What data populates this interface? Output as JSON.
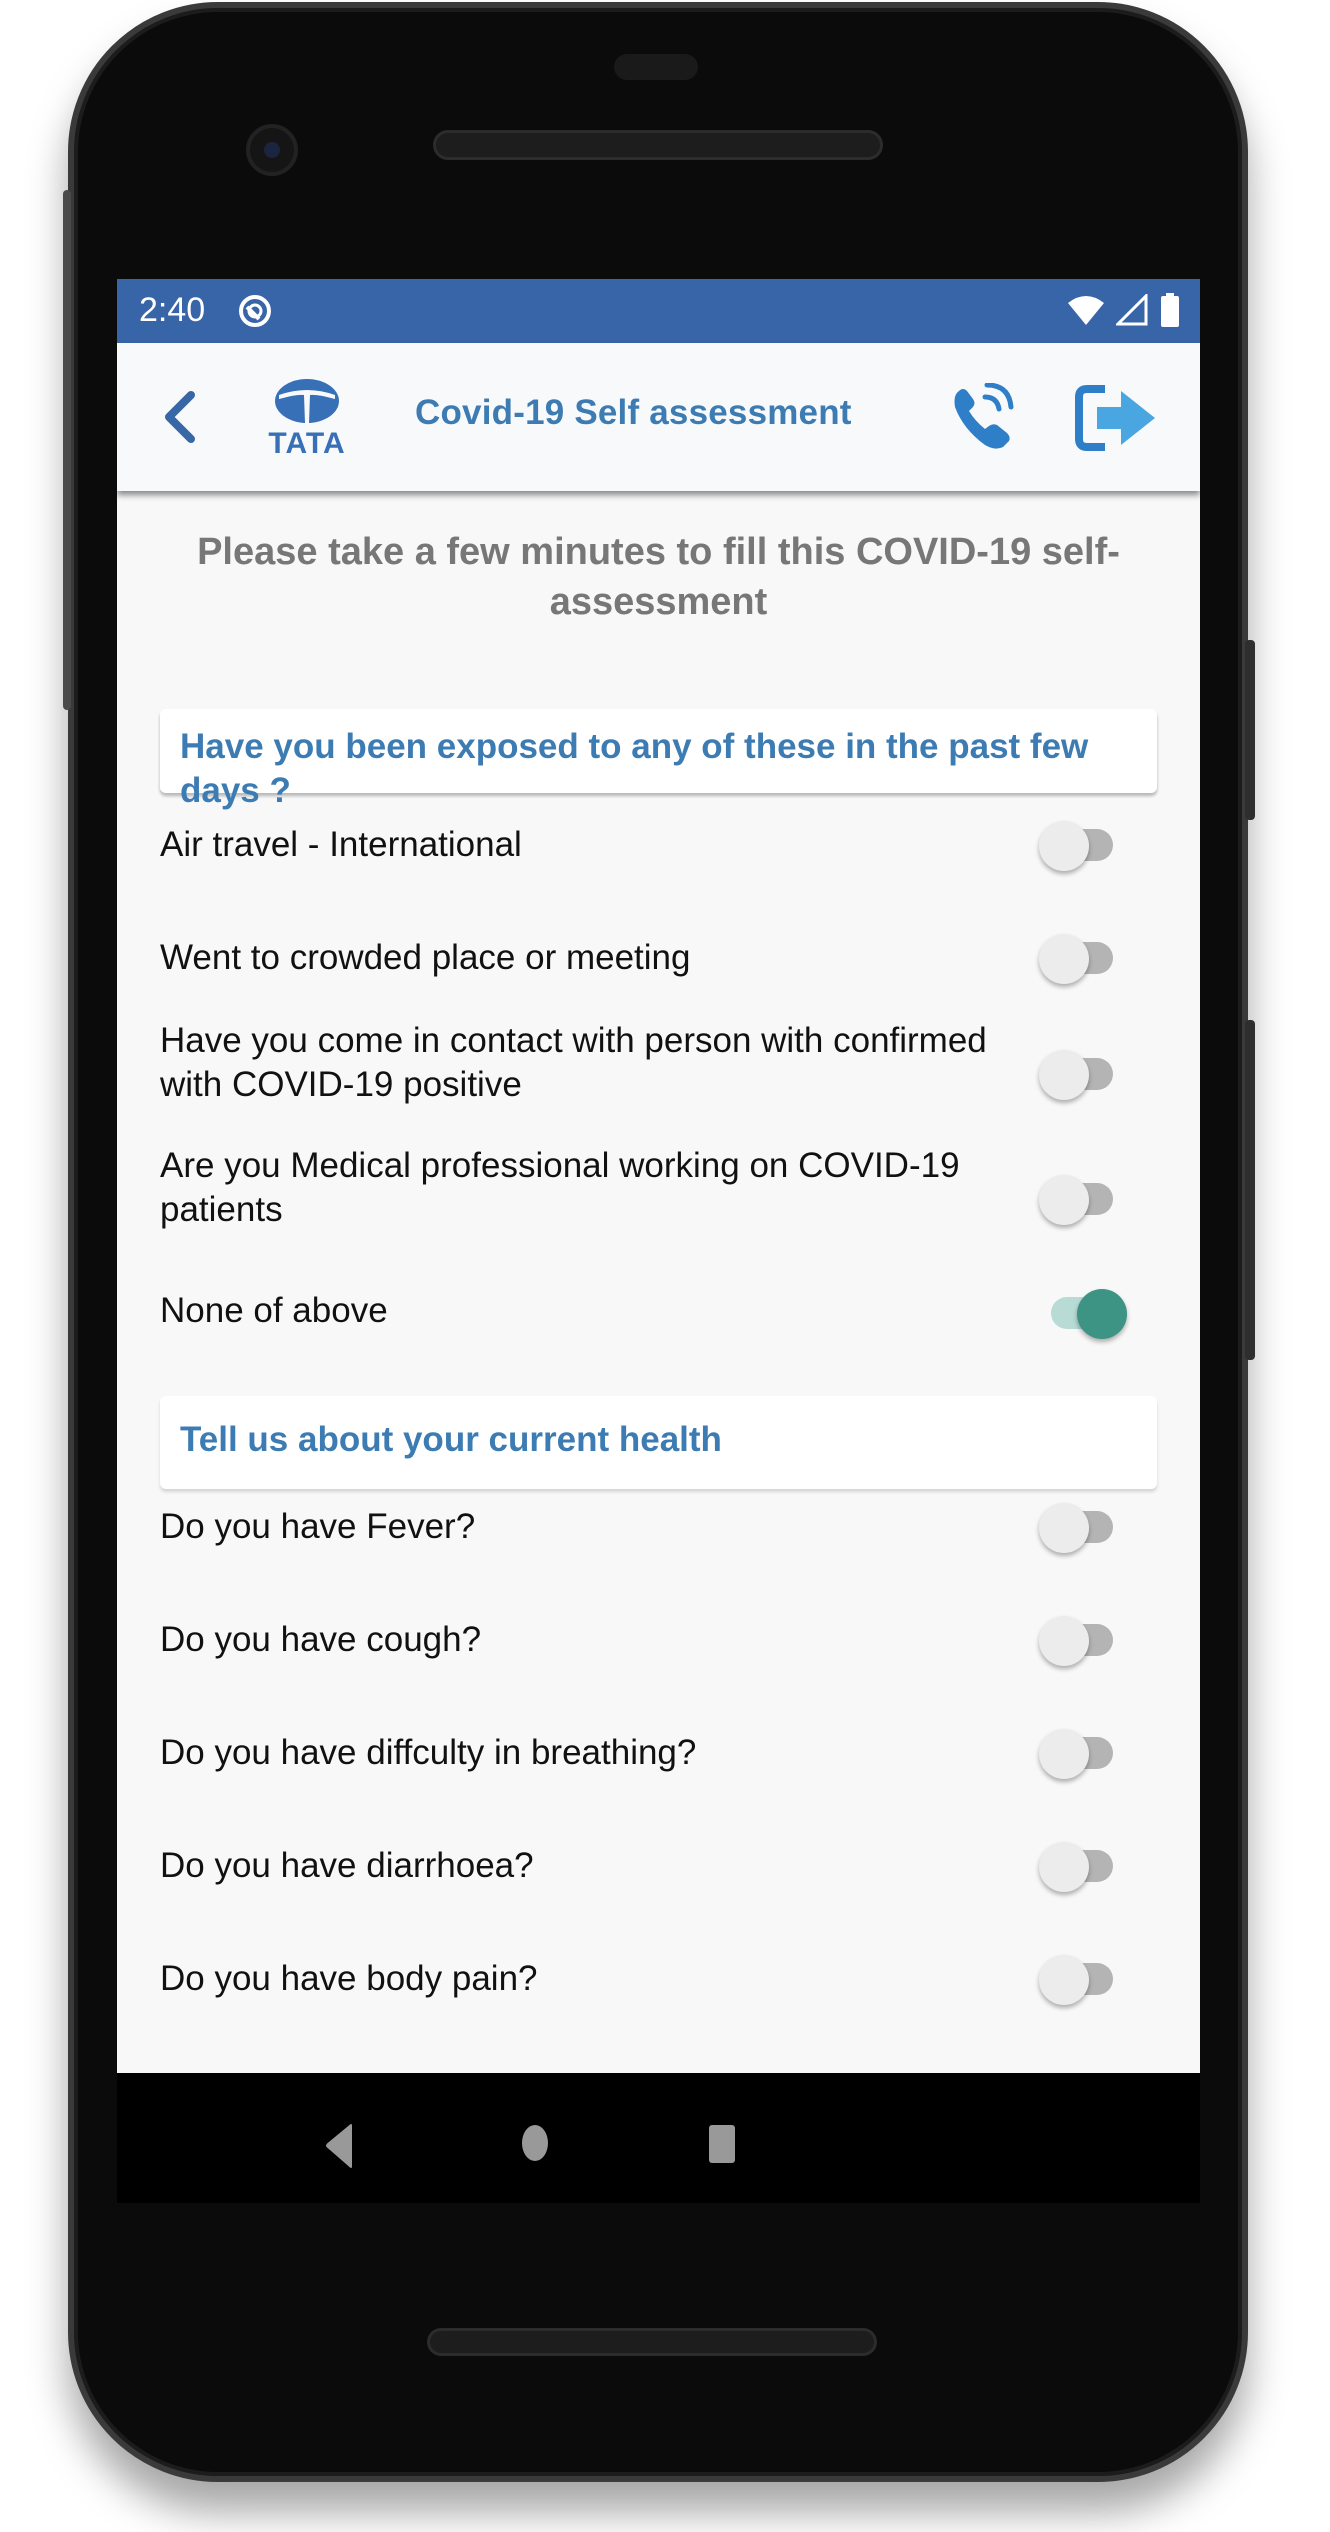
{
  "status_bar": {
    "time": "2:40",
    "icons": [
      "app-notification-icon",
      "wifi-icon",
      "signal-icon",
      "battery-icon"
    ],
    "background_color": "#3865a8"
  },
  "app_bar": {
    "back_icon": "chevron-left-icon",
    "logo_text": "TATA",
    "title": "Covid-19 Self assessment",
    "call_icon": "phone-call-icon",
    "logout_icon": "logout-icon",
    "accent_color": "#3d7cb3"
  },
  "intro_text": "Please take a few minutes to fill this COVID-19 self-assessment",
  "sections": [
    {
      "title": "Have you been exposed to any of these in the past few days ?",
      "questions": [
        {
          "label": "Air travel - International",
          "checked": false
        },
        {
          "label": "Went to crowded place or meeting",
          "checked": false
        },
        {
          "label": "Have you come in contact with person with confirmed with COVID-19 positive",
          "checked": false
        },
        {
          "label": "Are you Medical professional working on COVID-19 patients",
          "checked": false
        },
        {
          "label": "None of above",
          "checked": true
        }
      ]
    },
    {
      "title": "Tell us about your current health",
      "questions": [
        {
          "label": "Do you have Fever?",
          "checked": false
        },
        {
          "label": "Do you have cough?",
          "checked": false
        },
        {
          "label": "Do you have diffculty in breathing?",
          "checked": false
        },
        {
          "label": "Do you have diarrhoea?",
          "checked": false
        },
        {
          "label": "Do you have body pain?",
          "checked": false
        }
      ]
    }
  ],
  "switch_on_color": "#3d9485",
  "nav_bar": {
    "buttons": [
      "back-triangle-icon",
      "home-circle-icon",
      "recents-square-icon"
    ]
  }
}
